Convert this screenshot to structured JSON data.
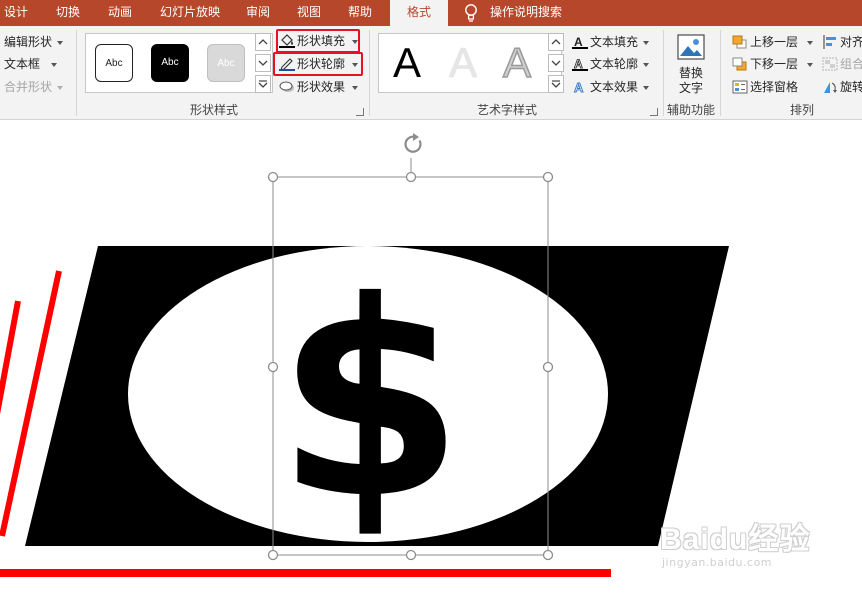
{
  "tabs": {
    "design": "设计",
    "transitions": "切换",
    "animations": "动画",
    "slideshow": "幻灯片放映",
    "review": "审阅",
    "view": "视图",
    "help": "帮助",
    "format": "格式",
    "tell_me": "操作说明搜索"
  },
  "insert_shapes": {
    "edit_shape": "编辑形状",
    "text_box": "文本框",
    "merge_shapes": "合并形状"
  },
  "shape_styles": {
    "group_label": "形状样式",
    "swatches": [
      "Abc",
      "Abc",
      "Abc"
    ],
    "shape_fill": "形状填充",
    "shape_outline": "形状轮廓",
    "shape_effects": "形状效果"
  },
  "wordart_styles": {
    "group_label": "艺术字样式",
    "samples": [
      "A",
      "A",
      "A"
    ],
    "text_fill": "文本填充",
    "text_outline": "文本轮廓",
    "text_effects": "文本效果"
  },
  "accessibility": {
    "group_label": "辅助功能",
    "alt_text_line1": "替换",
    "alt_text_line2": "文字"
  },
  "arrange": {
    "group_label": "排列",
    "bring_forward": "上移一层",
    "send_backward": "下移一层",
    "selection_pane": "选择窗格",
    "align": "对齐",
    "group": "组合",
    "rotate": "旋转"
  },
  "slide": {
    "symbol": "$"
  },
  "watermark": {
    "brand": "Baidu经验",
    "url": "jingyan.baidu.com"
  },
  "colors": {
    "tab_bar": "#b7472a",
    "ribbon_bg": "#f3f3f3",
    "highlight": "#e81123",
    "accent_red": "#ff0000"
  }
}
